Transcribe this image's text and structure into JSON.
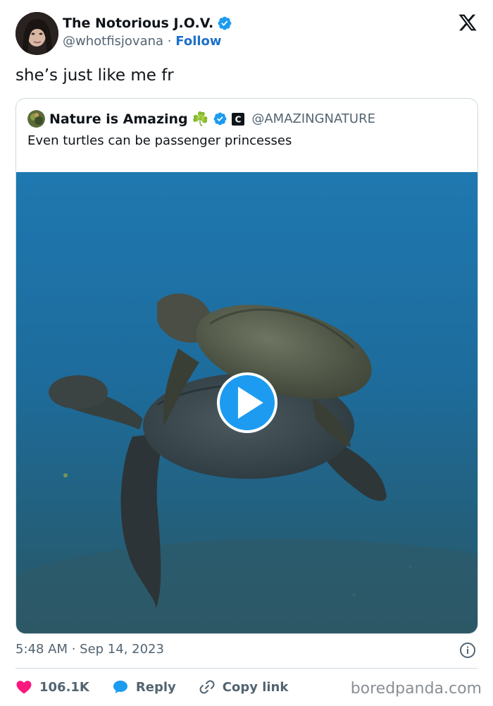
{
  "author": {
    "name": "The Notorious J.O.V.",
    "handle": "@whotfisjovana",
    "separator": "·",
    "follow_label": "Follow",
    "verified_icon": "verified-badge-icon",
    "verified_color": "#1d9bf0"
  },
  "tweet": {
    "text": "she’s just like me fr"
  },
  "quote": {
    "name": "Nature is Amazing",
    "emoji": "☘️",
    "handle": "@AMAZINGNATURE",
    "affiliate_badge": "C",
    "text": "Even turtles can be passenger princesses",
    "media_type": "video"
  },
  "meta": {
    "timestamp": "5:48 AM · Sep 14, 2023"
  },
  "actions": {
    "likes": "106.1K",
    "reply": "Reply",
    "copy_link": "Copy link"
  },
  "watermark": "boredpanda.com",
  "colors": {
    "accent": "#1d9bf0",
    "follow": "#1d70c9",
    "like": "#f91880",
    "water": "#1e6f9b"
  }
}
